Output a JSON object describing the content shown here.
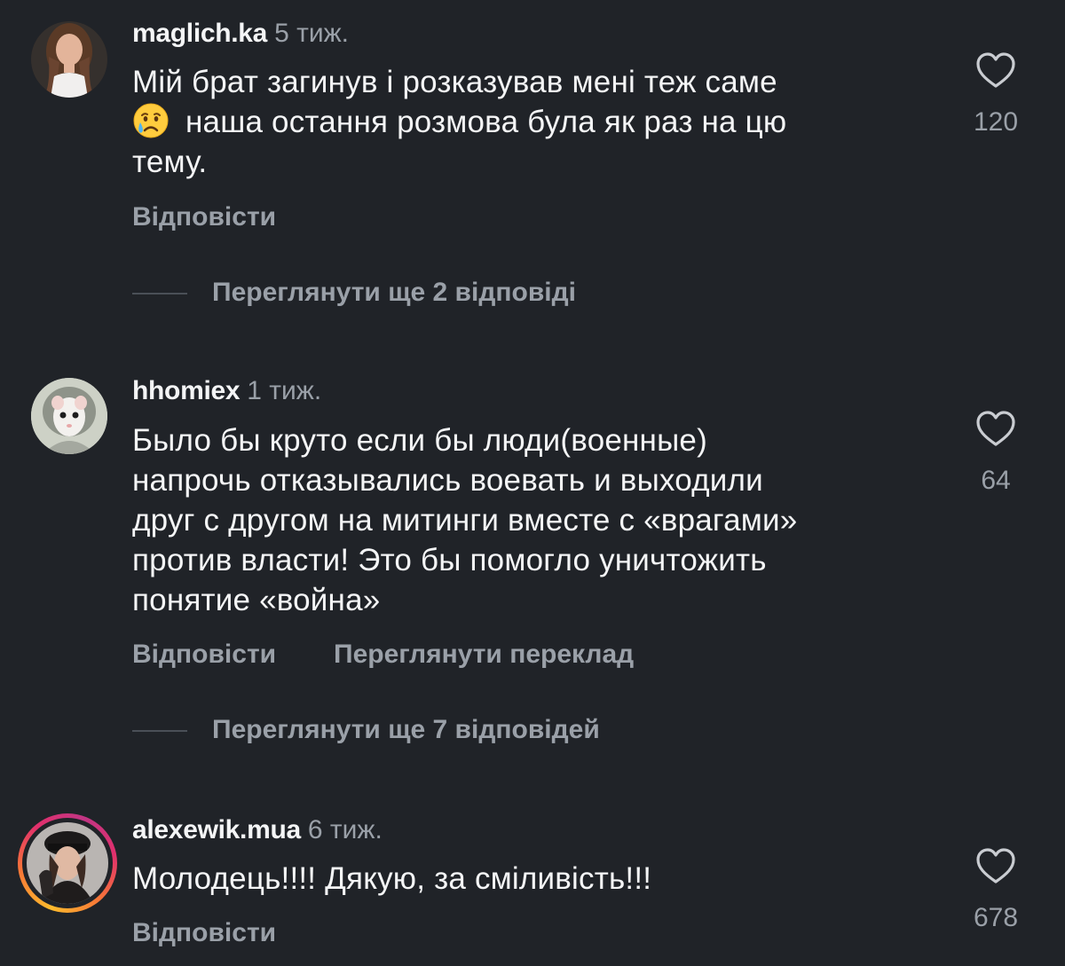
{
  "comments": [
    {
      "username": "maglich.ka",
      "time": "5 тиж.",
      "line1": "Мій брат загинув і розказував мені теж саме",
      "line2_emoji": "crying-face-emoji",
      "line2": "наша остання розмова була як раз на цю",
      "line3": "тему.",
      "reply_label": "Відповісти",
      "likes": "120",
      "view_replies": "Переглянути ще 2 відповіді"
    },
    {
      "username": "hhomiex",
      "time": "1 тиж.",
      "lines": [
        "Было бы круто если бы люди(военные)",
        "напрочь отказывались воевать и выходили",
        "друг с другом на митинги вместе с «врагами»",
        "против власти! Это бы помогло уничтожить",
        "понятие «война»"
      ],
      "reply_label": "Відповісти",
      "translate_label": "Переглянути переклад",
      "likes": "64",
      "view_replies": "Переглянути ще 7 відповідей"
    },
    {
      "username": "alexewik.mua",
      "time": "6 тиж.",
      "line1": "Молодець!!!! Дякую, за сміливість!!!",
      "reply_label": "Відповісти",
      "likes": "678"
    }
  ],
  "icons": {
    "like": "heart-outline-icon",
    "emoji": "crying-face-emoji"
  },
  "colors": {
    "background": "#202328",
    "primary_text": "#f4f5f6",
    "secondary_text": "#9aa0a8",
    "story_ring": [
      "#fdbb2d",
      "#e1306c",
      "#c13584"
    ]
  }
}
